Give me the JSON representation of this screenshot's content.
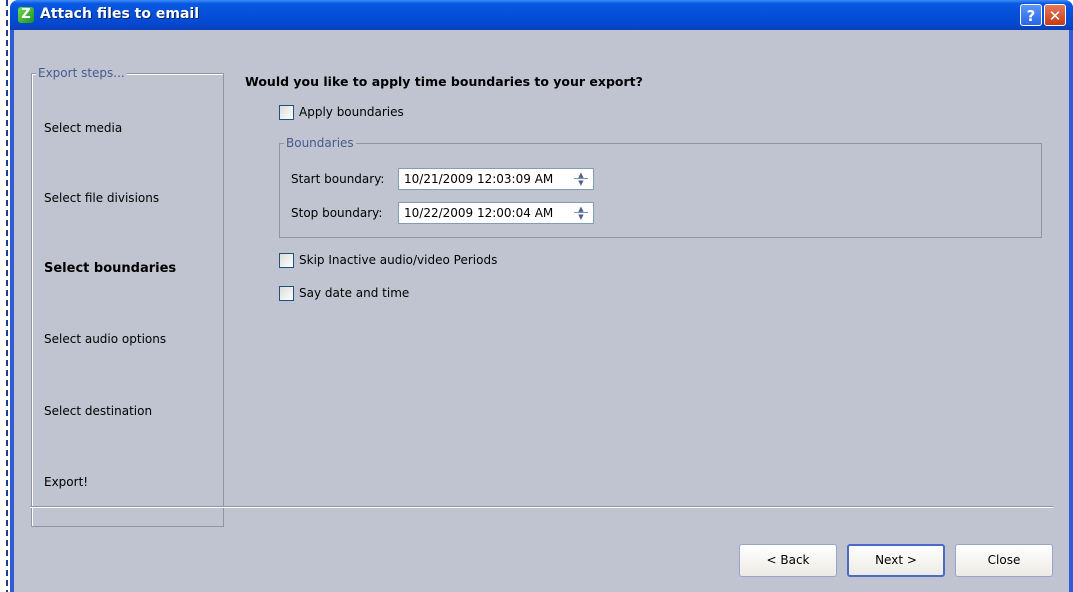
{
  "window": {
    "title": "Attach files to email",
    "help_glyph": "?",
    "close_glyph": "✕",
    "app_icon_glyph": "Z"
  },
  "steps": {
    "legend": "Export steps...",
    "items": [
      {
        "label": "Select media",
        "active": false
      },
      {
        "label": "Select file divisions",
        "active": false
      },
      {
        "label": "Select boundaries",
        "active": true
      },
      {
        "label": "Select audio options",
        "active": false
      },
      {
        "label": "Select destination",
        "active": false
      },
      {
        "label": "Export!",
        "active": false
      }
    ]
  },
  "main": {
    "question": "Would you like to apply time boundaries to your export?",
    "apply_boundaries": {
      "label": "Apply boundaries",
      "checked": false
    },
    "boundaries": {
      "legend": "Boundaries",
      "start_label": "Start boundary:",
      "start_value": "10/21/2009 12:03:09 AM",
      "stop_label": "Stop boundary:",
      "stop_value": "10/22/2009 12:00:04 AM"
    },
    "skip_inactive": {
      "label": "Skip Inactive audio/video Periods",
      "checked": false
    },
    "say_date_time": {
      "label": "Say date and time",
      "checked": false
    }
  },
  "buttons": {
    "back": "< Back",
    "next": "Next >",
    "close": "Close"
  }
}
